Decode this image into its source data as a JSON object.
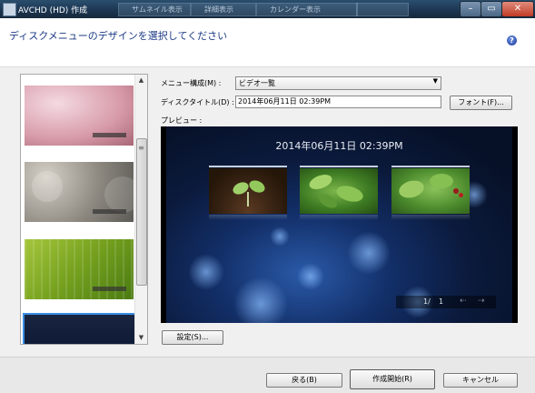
{
  "window": {
    "title": "AVCHD (HD) 作成",
    "taskbar_items": [
      "サムネイル表示",
      "詳細表示",
      "カレンダー表示"
    ]
  },
  "header": {
    "heading": "ディスクメニューのデザインを選択してください"
  },
  "form": {
    "menu_layout_label": "メニュー構成(M) :",
    "menu_layout_value": "ビデオ一覧",
    "disc_title_label": "ディスクタイトル(D) :",
    "disc_title_value": "2014年06月11日 02:39PM",
    "font_button": "フォント(F)...",
    "preview_label": "プレビュー :"
  },
  "preview": {
    "date_text": "2014年06月11日   02:39PM",
    "page_current": "1/",
    "page_total": "1",
    "prev_arrow": "⇠",
    "next_arrow": "⇢"
  },
  "buttons": {
    "settings": "設定(S)...",
    "back": "戻る(B)",
    "create": "作成開始(R)",
    "cancel": "キャンセル"
  },
  "icons": {
    "help": "?",
    "minimize": "–",
    "maximize": "▭",
    "close": "✕",
    "scroll_up": "▲",
    "scroll_down": "▼",
    "dropdown_arrow": "▼",
    "scroll_grip": "≡"
  }
}
